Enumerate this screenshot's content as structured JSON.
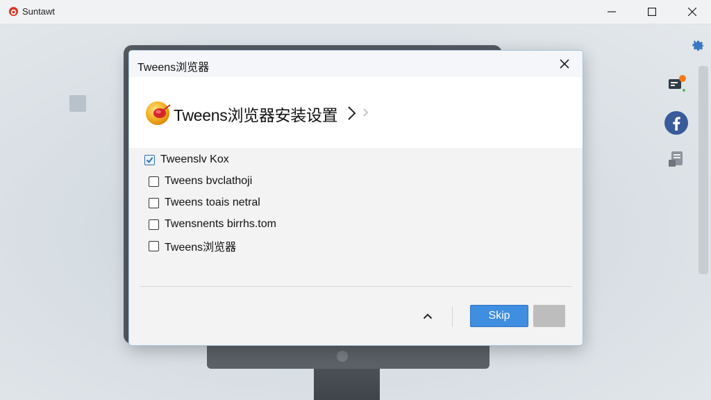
{
  "window": {
    "title": "Suntawt",
    "minimize_icon": "minimize-icon",
    "maximize_icon": "maximize-icon",
    "close_icon": "close-icon"
  },
  "side_icons": [
    "gear-icon",
    "notification-icon",
    "facebook-icon",
    "document-icon"
  ],
  "dialog": {
    "title": "Tweens浏览器",
    "heading": "Tweens浏览器安装设置",
    "heading_chevron": "›",
    "options": [
      {
        "label": "Tweenslv Kox",
        "checked": true
      },
      {
        "label": "Tweens bvclathoji",
        "checked": false
      },
      {
        "label": "Tweens toais netral",
        "checked": false
      },
      {
        "label": "Twensnents birrhs.tom",
        "checked": false
      },
      {
        "label": "Tweens浏览器",
        "checked": false
      }
    ],
    "skip_label": "Skip"
  },
  "colors": {
    "accent": "#3f8ee0",
    "facebook": "#3b5a9b",
    "checkbox_check": "#2f6fbd"
  }
}
